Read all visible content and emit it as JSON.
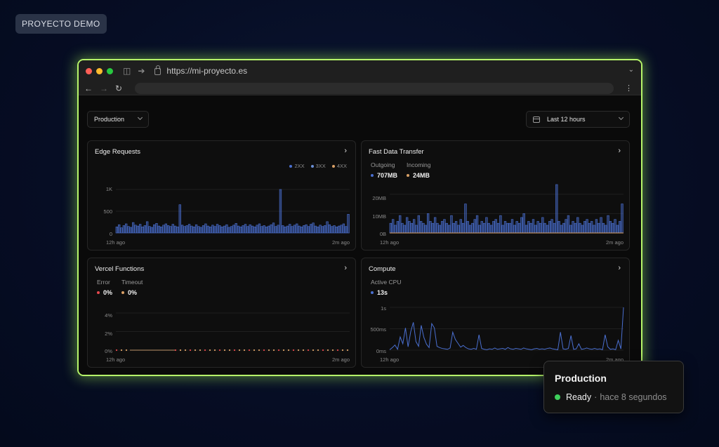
{
  "badge": "PROYECTO DEMO",
  "browser": {
    "url": "https://mi-proyecto.es"
  },
  "filters": {
    "environment": "Production",
    "range": "Last 12 hours"
  },
  "panels": {
    "edge": {
      "title": "Edge Requests",
      "legend": [
        "2XX",
        "3XX",
        "4XX"
      ],
      "y_ticks": [
        "1K",
        "500",
        "0"
      ],
      "x_start": "12h ago",
      "x_end": "2m ago"
    },
    "transfer": {
      "title": "Fast Data Transfer",
      "stats": [
        {
          "label": "Outgoing",
          "value": "707MB"
        },
        {
          "label": "Incoming",
          "value": "24MB"
        }
      ],
      "y_ticks": [
        "20MB",
        "10MB",
        "0B"
      ],
      "x_start": "12h ago",
      "x_end": "2m ago"
    },
    "functions": {
      "title": "Vercel Functions",
      "stats": [
        {
          "label": "Error",
          "value": "0%"
        },
        {
          "label": "Timeout",
          "value": "0%"
        }
      ],
      "y_ticks": [
        "4%",
        "2%",
        "0%"
      ],
      "x_start": "12h ago",
      "x_end": "2m ago"
    },
    "compute": {
      "title": "Compute",
      "stats": [
        {
          "label": "Active CPU",
          "value": "13s"
        }
      ],
      "y_ticks": [
        "1s",
        "500ms",
        "0ms"
      ],
      "x_start": "12h ago",
      "x_end": "2m ago"
    }
  },
  "toast": {
    "title": "Production",
    "status": "Ready",
    "separator": "·",
    "time": "hace 8 segundos"
  },
  "colors": {
    "blue": "#4a6fd0",
    "orange": "#d9a066",
    "red": "#e5484d",
    "green": "#3ecf5b",
    "accent_border": "#b6f56a"
  },
  "icons": [
    "sidebar-icon",
    "back-arrow-icon",
    "lock-icon",
    "chevron-down-icon",
    "nav-back-icon",
    "nav-forward-icon",
    "reload-icon",
    "more-vertical-icon",
    "calendar-icon",
    "chevron-right-icon"
  ],
  "chart_data": [
    {
      "type": "bar",
      "title": "Edge Requests",
      "x_range": [
        "12h ago",
        "2m ago"
      ],
      "ylim": [
        0,
        1000
      ],
      "y_ticks": [
        0,
        500,
        1000
      ],
      "series": [
        {
          "name": "2XX",
          "color": "#4a6fd0",
          "values": [
            140,
            190,
            120,
            170,
            210,
            150,
            130,
            240,
            180,
            160,
            200,
            140,
            170,
            260,
            150,
            130,
            190,
            220,
            160,
            140,
            180,
            210,
            170,
            150,
            200,
            160,
            140,
            650,
            180,
            150,
            170,
            200,
            160,
            140,
            190,
            150,
            130,
            170,
            210,
            160,
            140,
            180,
            150,
            200,
            170,
            140,
            160,
            190,
            130,
            150,
            180,
            220,
            160,
            140,
            170,
            200,
            150,
            190,
            160,
            140,
            180,
            210,
            150,
            170,
            140,
            160,
            190,
            230,
            150,
            180,
            1240,
            170,
            140,
            160,
            200,
            150,
            180,
            210,
            160,
            140,
            170,
            190,
            150,
            200,
            230,
            160,
            140,
            180,
            150,
            170,
            260,
            190,
            150,
            170,
            140,
            160,
            180,
            210,
            150,
            430
          ]
        },
        {
          "name": "3XX",
          "color": "#6b8fd6",
          "values": []
        },
        {
          "name": "4XX",
          "color": "#d9a066",
          "values": []
        }
      ]
    },
    {
      "type": "bar",
      "title": "Fast Data Transfer",
      "x_range": [
        "12h ago",
        "2m ago"
      ],
      "ylim": [
        0,
        25
      ],
      "y_ticks": [
        0,
        10,
        20
      ],
      "series": [
        {
          "name": "Outgoing",
          "color": "#4a6fd0",
          "values": [
            5,
            7,
            4,
            6,
            9,
            5,
            4,
            8,
            6,
            5,
            7,
            4,
            9,
            6,
            5,
            4,
            10,
            6,
            5,
            8,
            5,
            4,
            6,
            7,
            5,
            4,
            9,
            5,
            6,
            4,
            7,
            5,
            15,
            6,
            4,
            5,
            7,
            9,
            4,
            6,
            5,
            8,
            5,
            4,
            6,
            7,
            5,
            9,
            4,
            6,
            5,
            5,
            7,
            4,
            6,
            5,
            8,
            10,
            4,
            6,
            5,
            7,
            4,
            6,
            5,
            8,
            5,
            4,
            6,
            7,
            5,
            25,
            6,
            4,
            5,
            7,
            9,
            4,
            6,
            5,
            8,
            5,
            4,
            6,
            7,
            5,
            6,
            4,
            7,
            5,
            8,
            5,
            4,
            9,
            6,
            5,
            7,
            4,
            6,
            15
          ]
        },
        {
          "name": "Incoming",
          "color": "#d9a066",
          "values": []
        }
      ]
    },
    {
      "type": "scatter",
      "title": "Vercel Functions",
      "x_range": [
        "12h ago",
        "2m ago"
      ],
      "ylim": [
        0,
        5
      ],
      "y_ticks": [
        0,
        2,
        4
      ],
      "series": [
        {
          "name": "Error",
          "color": "#e5484d",
          "values": []
        },
        {
          "name": "Timeout",
          "color": "#d9a066",
          "values": []
        }
      ]
    },
    {
      "type": "line",
      "title": "Compute",
      "x_range": [
        "12h ago",
        "2m ago"
      ],
      "ylim": [
        0,
        1000
      ],
      "y_ticks": [
        0,
        500,
        1000
      ],
      "series": [
        {
          "name": "Active CPU",
          "color": "#4a6fd0",
          "values": [
            10,
            60,
            120,
            20,
            310,
            150,
            520,
            80,
            430,
            650,
            200,
            90,
            580,
            300,
            140,
            60,
            620,
            520,
            90,
            60,
            40,
            30,
            20,
            50,
            420,
            250,
            160,
            70,
            110,
            60,
            30,
            20,
            40,
            20,
            360,
            40,
            20,
            10,
            30,
            20,
            50,
            20,
            30,
            40,
            20,
            60,
            30,
            20,
            40,
            30,
            20,
            50,
            30,
            20,
            10,
            30,
            40,
            20,
            30,
            20,
            40,
            50,
            30,
            20,
            10,
            420,
            30,
            20,
            40,
            340,
            20,
            30,
            150,
            20,
            30,
            50,
            30,
            20,
            40,
            20,
            30,
            10,
            360,
            80,
            20,
            30,
            10,
            230,
            30,
            1000
          ]
        }
      ]
    }
  ]
}
